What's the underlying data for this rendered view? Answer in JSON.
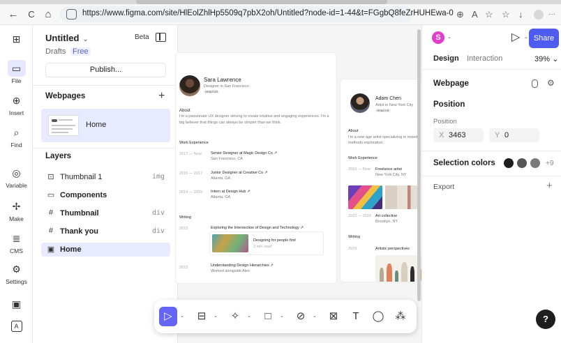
{
  "browser": {
    "url": "https://www.figma.com/site/HlEolZhlHp5509q7pbX2oh/Untitled?node-id=1-44&t=FGgbQ8feZrHUHEwa-0",
    "back_glyph": "←",
    "reload_glyph": "C",
    "home_glyph": "⌂",
    "zoom_glyph": "⊕",
    "reader_glyph": "A",
    "fav_glyph": "☆",
    "favs_glyph": "☆",
    "dl_glyph": "↓",
    "more_glyph": "···"
  },
  "rail": {
    "logo_glyph": "⊞",
    "items": [
      {
        "label": "File",
        "glyph": "▭"
      },
      {
        "label": "Insert",
        "glyph": "⊕"
      },
      {
        "label": "Find",
        "glyph": "⌕"
      },
      {
        "label": "Variable",
        "glyph": "◎"
      },
      {
        "label": "Make",
        "glyph": "✢"
      },
      {
        "label": "CMS",
        "glyph": "≣"
      },
      {
        "label": "Settings",
        "glyph": "⚙"
      }
    ],
    "bottom_glyph_1": "▣",
    "bottom_glyph_2": "A"
  },
  "left_panel": {
    "title": "Untitled",
    "title_chevron": "⌄",
    "beta": "Beta",
    "drafts": "Drafts",
    "plan": "Free",
    "publish": "Publish...",
    "webpages_title": "Webpages",
    "add_glyph": "+",
    "pages": [
      {
        "name": "Home"
      }
    ],
    "layers_title": "Layers",
    "layers": [
      {
        "icon": "⊡",
        "name": "Thumbnail 1",
        "type": "img",
        "bold": false
      },
      {
        "icon": "▭",
        "name": "Components",
        "type": "",
        "bold": true
      },
      {
        "icon": "#",
        "name": "Thumbnail",
        "type": "div",
        "bold": true
      },
      {
        "icon": "#",
        "name": "Thank you",
        "type": "div",
        "bold": true
      },
      {
        "icon": "▣",
        "name": "Home",
        "type": "",
        "bold": true
      }
    ]
  },
  "canvas": {
    "frame1": {
      "name": "Sara Lawrence",
      "role": "Designer in San Francisco",
      "tag": "Head UX",
      "about_title": "About",
      "about_text_1": "I'm a passionate UX designer striving to create intuitive and engaging experiences. I'm a",
      "about_text_2": "big believer that things can always be simpler than we think.",
      "work_title": "Work Experience",
      "jobs": [
        {
          "period": "2017 — Now",
          "title": "Senior Designer at Magic Design Co ↗",
          "place": "San Francisco, CA"
        },
        {
          "period": "2015 — 2017",
          "title": "Junior Designer at Creative Co ↗",
          "place": "Atlanta, GA"
        },
        {
          "period": "2014 — 2015",
          "title": "Intern at Design Hub ↗",
          "place": "Atlanta, GA"
        }
      ],
      "writing_title": "Writing",
      "posts": [
        {
          "year": "2023",
          "title": "Exploring the Intersection of Design and Technology ↗"
        },
        {
          "year": "2023",
          "title": "Understanding Design Hierarchies ↗",
          "sub": "Worked alongside Alex"
        }
      ],
      "card_title": "Designing for people first",
      "card_meta": "2 min read"
    },
    "frame2": {
      "name": "Adam Chen",
      "role": "Artist in New York City",
      "tag": "Head Art",
      "about_title": "About",
      "about_text_1": "I'm a new age artist specializing in mixed",
      "about_text_2": "methods exploration.",
      "work_title": "Work Experience",
      "job_period": "2016 — Now",
      "job_title": "Freelance artist",
      "job_place": "New York City, NY",
      "job2_period": "2015 — 2016",
      "job2_title": "Art collective",
      "job2_place": "Brooklyn, NY",
      "writing_title": "Writing",
      "post_year": "2023",
      "post_title": "Artistic perspectives"
    }
  },
  "toolbar": {
    "tools": [
      {
        "name": "move-tool",
        "glyph": "▷"
      },
      {
        "name": "frame-tool",
        "glyph": "⊟"
      },
      {
        "name": "component-tool",
        "glyph": "✧"
      },
      {
        "name": "shape-tool",
        "glyph": "□"
      },
      {
        "name": "pen-tool",
        "glyph": "⊘"
      },
      {
        "name": "image-tool",
        "glyph": "⊠"
      },
      {
        "name": "text-tool",
        "glyph": "T"
      },
      {
        "name": "comment-tool",
        "glyph": "◯"
      },
      {
        "name": "plugins-tool",
        "glyph": "⁂"
      }
    ],
    "chevron": "⌄"
  },
  "right_panel": {
    "user_initial": "S",
    "play_glyph": "▷",
    "chevron": "⌄",
    "share": "Share",
    "tab_design": "Design",
    "tab_interaction": "Interaction",
    "zoom": "39% ⌄",
    "webpage_title": "Webpage",
    "position_title": "Position",
    "position_label": "Position",
    "x_label": "X",
    "x_value": "3463",
    "y_label": "Y",
    "y_value": "0",
    "selection_colors_title": "Selection colors",
    "more_colors": "+9",
    "export_title": "Export",
    "add_glyph": "+",
    "help": "?",
    "swatch_colors": [
      "#1e1e1e",
      "#555555",
      "#7a7a7a"
    ],
    "accent_color": "#4e5cf2"
  }
}
